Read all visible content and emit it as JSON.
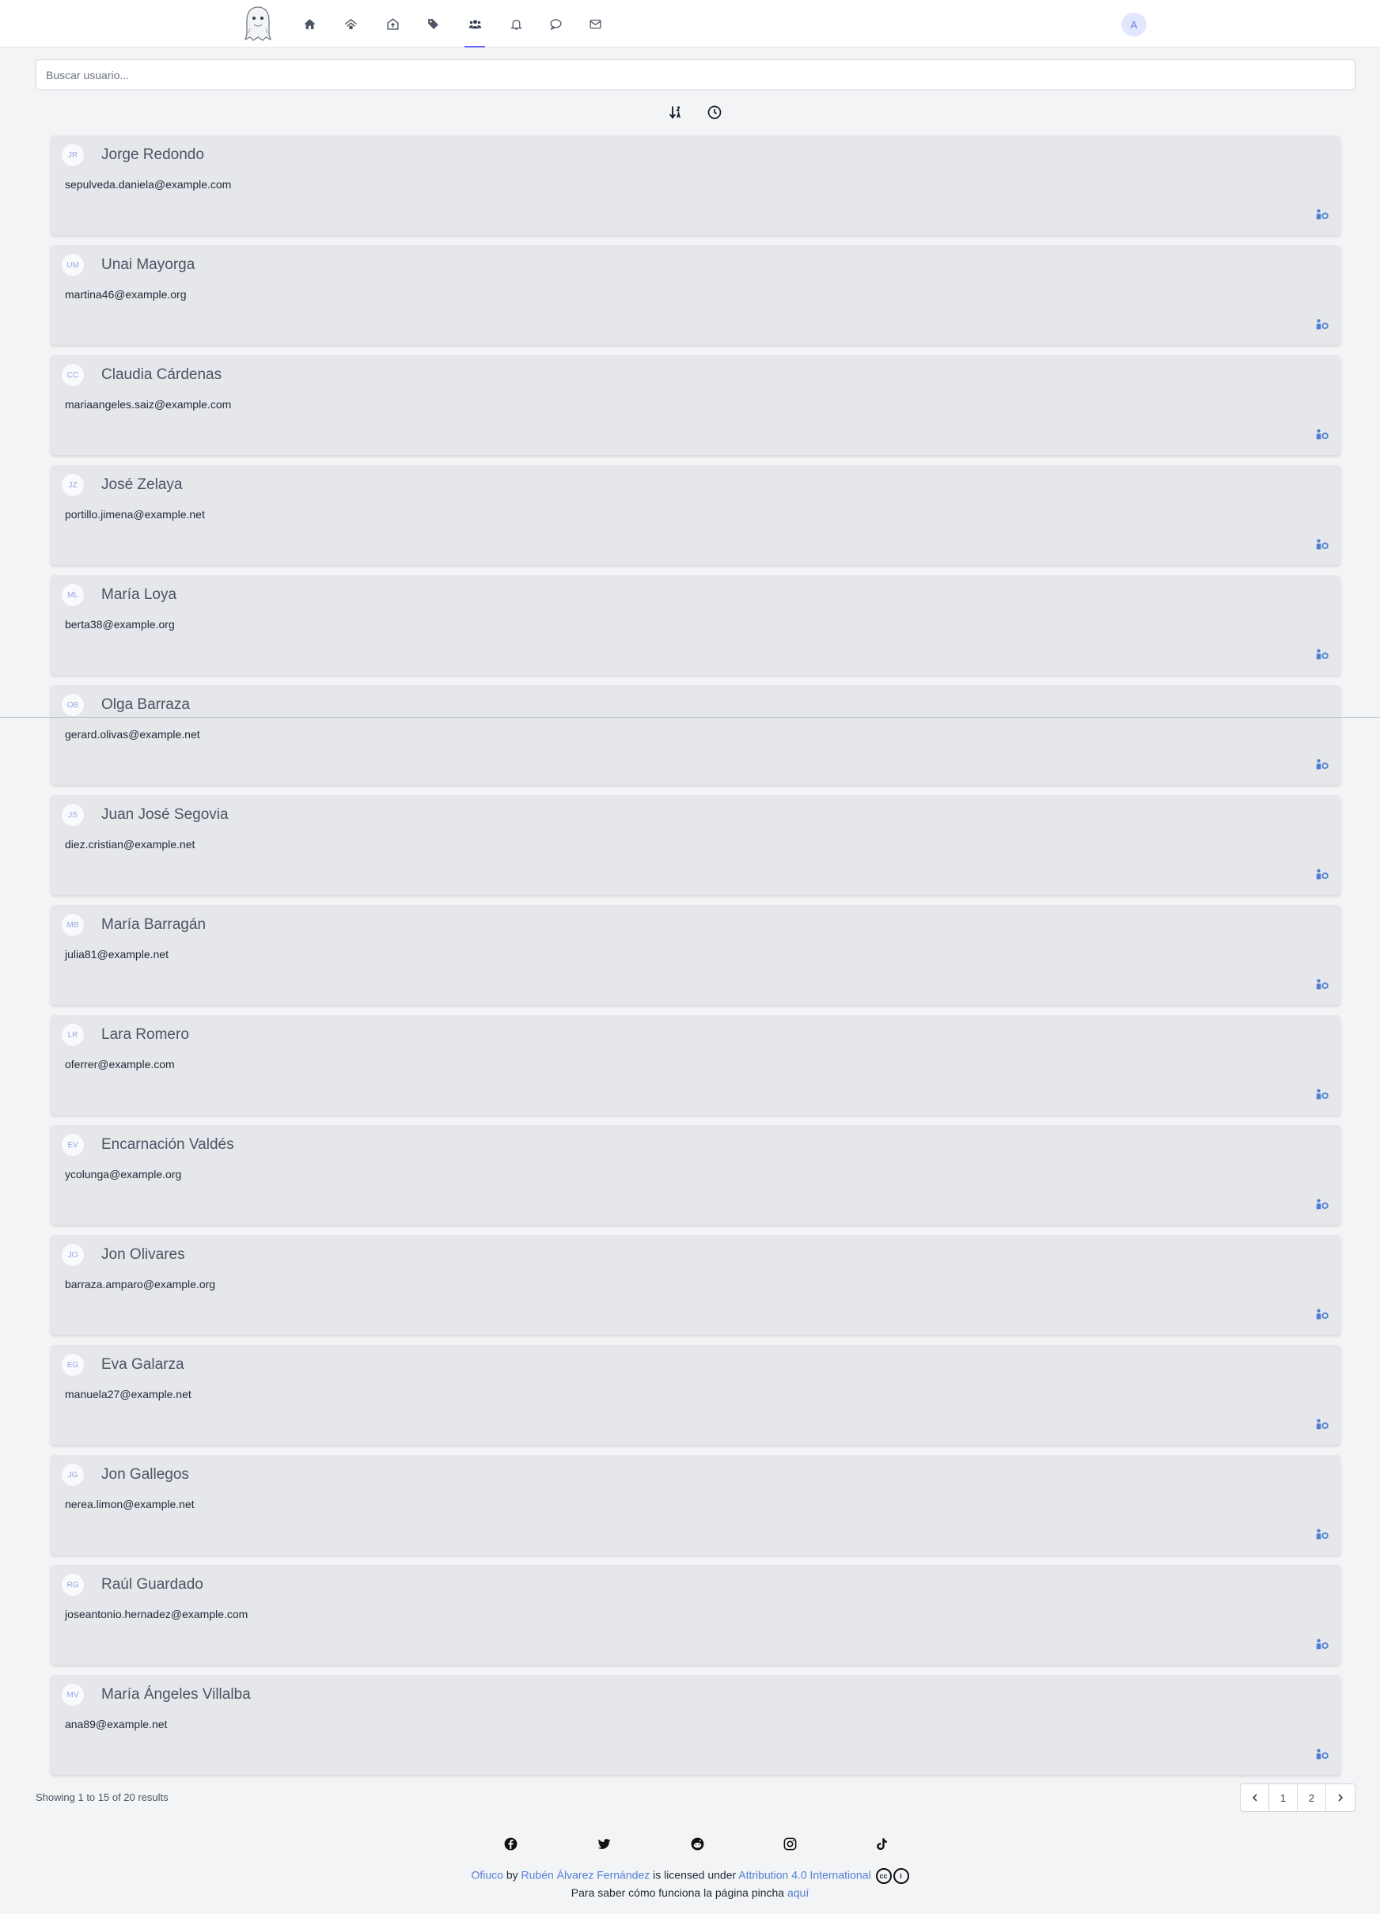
{
  "nav": {
    "logo": "ghost-logo",
    "items": [
      {
        "icon": "home-icon"
      },
      {
        "icon": "community-icon"
      },
      {
        "icon": "upload-icon"
      },
      {
        "icon": "tags-icon"
      },
      {
        "icon": "users-icon",
        "active": true
      },
      {
        "icon": "bell-icon"
      },
      {
        "icon": "chat-icon"
      },
      {
        "icon": "mail-icon"
      }
    ],
    "avatar_initial": "A"
  },
  "search": {
    "placeholder": "Buscar usuario..."
  },
  "sort": {
    "alpha_icon": "sort-alpha-icon",
    "time_icon": "clock-icon"
  },
  "users": [
    {
      "initials": "JR",
      "name": "Jorge Redondo",
      "email": "sepulveda.daniela@example.com"
    },
    {
      "initials": "UM",
      "name": "Unai Mayorga",
      "email": "martina46@example.org"
    },
    {
      "initials": "CC",
      "name": "Claudia Cárdenas",
      "email": "mariaangeles.saiz@example.com"
    },
    {
      "initials": "JZ",
      "name": "José Zelaya",
      "email": "portillo.jimena@example.net"
    },
    {
      "initials": "ML",
      "name": "María Loya",
      "email": "berta38@example.org"
    },
    {
      "initials": "OB",
      "name": "Olga Barraza",
      "email": "gerard.olivas@example.net"
    },
    {
      "initials": "JS",
      "name": "Juan José Segovia",
      "email": "diez.cristian@example.net"
    },
    {
      "initials": "MB",
      "name": "María Barragán",
      "email": "julia81@example.net"
    },
    {
      "initials": "LR",
      "name": "Lara Romero",
      "email": "oferrer@example.com"
    },
    {
      "initials": "EV",
      "name": "Encarnación Valdés",
      "email": "ycolunga@example.org"
    },
    {
      "initials": "JO",
      "name": "Jon Olivares",
      "email": "barraza.amparo@example.org"
    },
    {
      "initials": "EG",
      "name": "Eva Galarza",
      "email": "manuela27@example.net"
    },
    {
      "initials": "JG",
      "name": "Jon Gallegos",
      "email": "nerea.limon@example.net"
    },
    {
      "initials": "RG",
      "name": "Raúl Guardado",
      "email": "joseantonio.hernadez@example.com"
    },
    {
      "initials": "MV",
      "name": "María Ángeles Villalba",
      "email": "ana89@example.net"
    }
  ],
  "pagination": {
    "summary": "Showing 1 to 15 of 20 results",
    "pages": [
      "1",
      "2"
    ]
  },
  "footer": {
    "social": [
      "facebook-icon",
      "twitter-icon",
      "reddit-icon",
      "instagram-icon",
      "tiktok-icon"
    ],
    "brand": "Ofiuco",
    "by": "by",
    "author": "Rubén Álvarez Fernández",
    "licensed": "is licensed under",
    "license": "Attribution 4.0 International",
    "help_text": "Para saber cómo funciona la página pincha",
    "help_link": "aquí"
  },
  "colors": {
    "accent": "#4f7fd4",
    "card_bg": "#e5e7eb",
    "page_bg": "#f3f4f6"
  }
}
